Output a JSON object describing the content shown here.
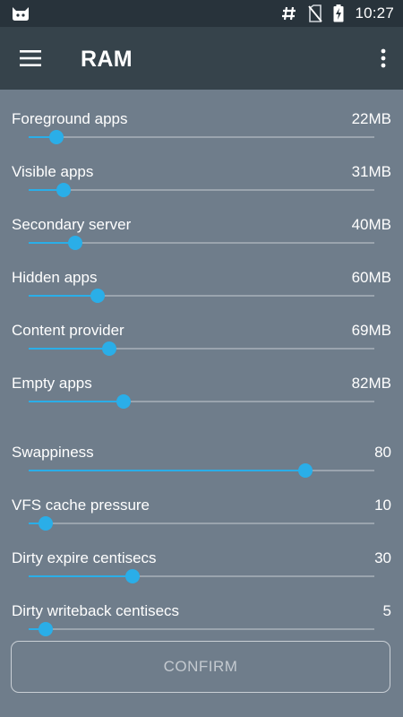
{
  "status_bar": {
    "time": "10:27",
    "icons": [
      "cyanogenmod-bot-icon",
      "hash-icon",
      "no-sim-icon",
      "battery-charging-icon"
    ]
  },
  "toolbar": {
    "title": "RAM",
    "menu_icon": "hamburger-menu-icon",
    "more_icon": "overflow-menu-icon"
  },
  "accent_color": "#2aaee8",
  "settings": [
    {
      "label": "Foreground apps",
      "value": "22MB",
      "level": 0.08
    },
    {
      "label": "Visible apps",
      "value": "31MB",
      "level": 0.1
    },
    {
      "label": "Secondary server",
      "value": "40MB",
      "level": 0.135
    },
    {
      "label": "Hidden apps",
      "value": "60MB",
      "level": 0.2
    },
    {
      "label": "Content provider",
      "value": "69MB",
      "level": 0.233
    },
    {
      "label": "Empty apps",
      "value": "82MB",
      "level": 0.275
    },
    {
      "label": "Swappiness",
      "value": "80",
      "level": 0.8
    },
    {
      "label": "VFS cache pressure",
      "value": "10",
      "level": 0.05
    },
    {
      "label": "Dirty expire centisecs",
      "value": "30",
      "level": 0.3
    },
    {
      "label": "Dirty writeback centisecs",
      "value": "5",
      "level": 0.05
    }
  ],
  "confirm_label": "CONFIRM"
}
